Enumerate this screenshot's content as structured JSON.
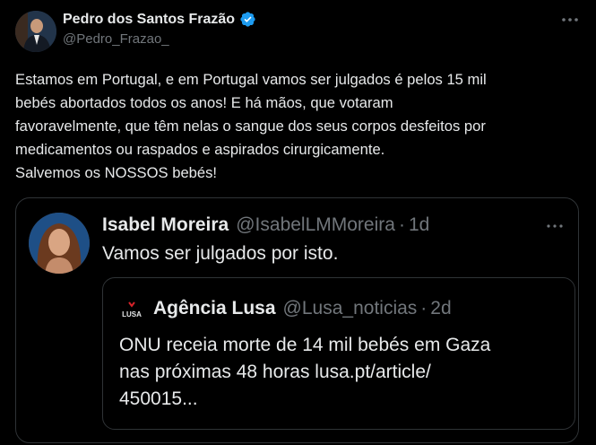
{
  "tweet": {
    "author_name": "Pedro dos Santos Frazão",
    "author_handle": "@Pedro_Frazao_",
    "text": "Estamos em Portugal, e em Portugal vamos ser julgados é pelos 15 mil\nbebés abortados todos os anos! E há mãos, que votaram\nfavoravelmente, que têm nelas o sangue dos seus corpos desfeitos por\nmedicamentos ou raspados e aspirados cirurgicamente.\nSalvemos os NOSSOS bebés!",
    "icons": {
      "verified": "verified-badge-icon",
      "more": "more-options-icon"
    }
  },
  "quote": {
    "author_name": "Isabel Moreira",
    "author_handle": "@IsabelLMMoreira",
    "separator": "·",
    "time": "1d",
    "text": "Vamos ser julgados por isto.",
    "nested": {
      "logo_text": "LUSA",
      "author_name": "Agência Lusa",
      "author_handle": "@Lusa_noticias",
      "separator": "·",
      "time": "2d",
      "text": "ONU receia morte de 14 mil bebés em Gaza\nnas próximas 48 horas  lusa.pt/article/\n450015..."
    }
  },
  "colors": {
    "background": "#000000",
    "text_primary": "#e7e9ea",
    "text_secondary": "#71767b",
    "verified_blue": "#1d9bf0",
    "border": "#2f3336",
    "lusa_red": "#d8232a"
  }
}
